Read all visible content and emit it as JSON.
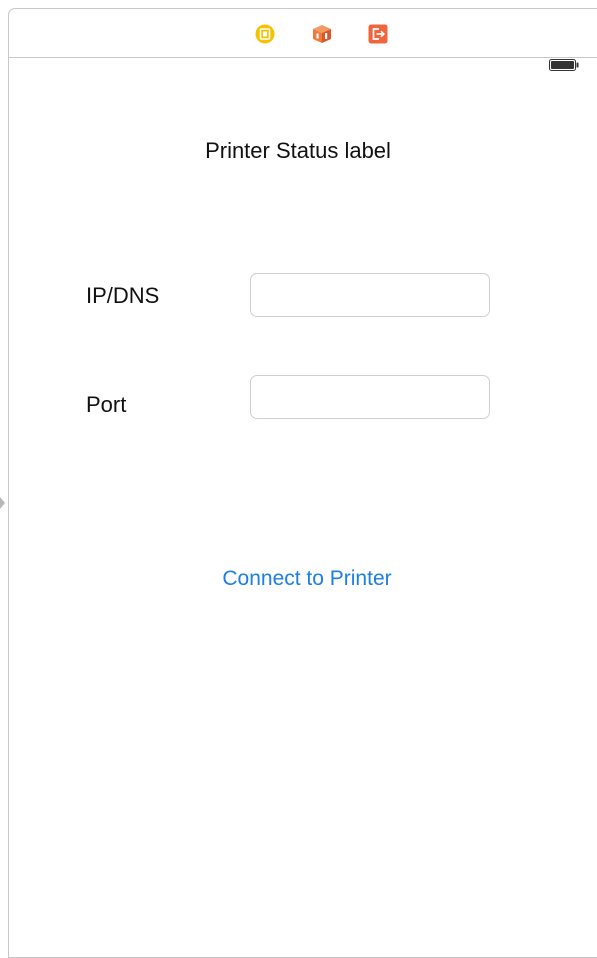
{
  "scene": {
    "dock_icons": [
      "view-controller-icon",
      "first-responder-icon",
      "exit-icon"
    ],
    "status_bar": {
      "battery_icon": "battery-icon"
    }
  },
  "status_label": "Printer Status label",
  "form": {
    "ip_label": "IP/DNS",
    "ip_value": "",
    "ip_placeholder": "",
    "port_label": "Port",
    "port_value": "",
    "port_placeholder": ""
  },
  "connect_button_label": "Connect to Printer",
  "colors": {
    "accent": "#1a7fe8",
    "view_controller_icon": "#f5c100",
    "first_responder_icon": "#f07a3c",
    "exit_icon": "#f0653c"
  }
}
